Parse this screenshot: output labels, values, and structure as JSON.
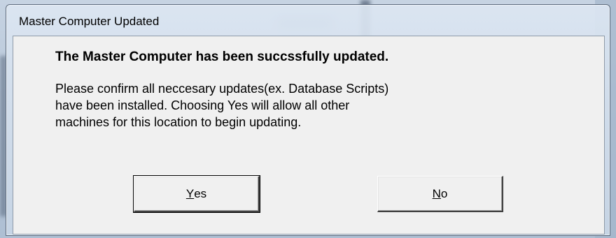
{
  "window": {
    "title": "Master Computer Updated"
  },
  "dialog": {
    "heading": "The Master Computer has been succssfully updated.",
    "message_lines": [
      "Please confirm all neccesary updates(ex. Database Scripts)",
      "have been installed.  Choosing Yes will allow all other",
      "machines for this location to begin updating."
    ]
  },
  "buttons": {
    "yes": {
      "accel": "Y",
      "rest": "es"
    },
    "no": {
      "accel": "N",
      "rest": "o"
    }
  }
}
